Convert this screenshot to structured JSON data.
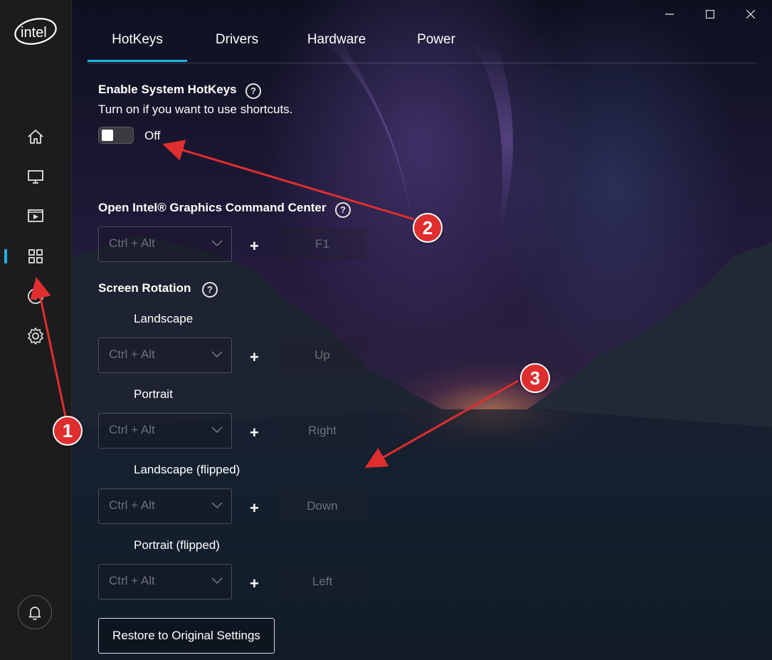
{
  "app": {
    "logo_text": "intel",
    "accent_color": "#1fb3e8",
    "annotation_color": "#e02e2e"
  },
  "sidebar": {
    "items": [
      {
        "icon": "home-icon"
      },
      {
        "icon": "display-icon"
      },
      {
        "icon": "video-icon"
      },
      {
        "icon": "apps-grid-icon",
        "active": true
      },
      {
        "icon": "help-icon"
      },
      {
        "icon": "settings-gear-icon"
      }
    ],
    "bottom_icon": "bell-icon"
  },
  "window_controls": [
    "minimize-icon",
    "maximize-icon",
    "close-icon"
  ],
  "tabs": [
    {
      "label": "HotKeys",
      "active": true
    },
    {
      "label": "Drivers"
    },
    {
      "label": "Hardware"
    },
    {
      "label": "Power"
    }
  ],
  "hotkeys": {
    "enable": {
      "title": "Enable System HotKeys",
      "description": "Turn on if you want to use shortcuts.",
      "toggle_state": "Off",
      "help": "?"
    },
    "open_igcc": {
      "title": "Open Intel® Graphics Command Center",
      "help": "?",
      "modifier": "Ctrl + Alt",
      "plus": "+",
      "key": "F1"
    },
    "screen_rotation": {
      "title": "Screen Rotation",
      "help": "?",
      "items": [
        {
          "label": "Landscape",
          "modifier": "Ctrl + Alt",
          "plus": "+",
          "key": "Up"
        },
        {
          "label": "Portrait",
          "modifier": "Ctrl + Alt",
          "plus": "+",
          "key": "Right"
        },
        {
          "label": "Landscape (flipped)",
          "modifier": "Ctrl + Alt",
          "plus": "+",
          "key": "Down"
        },
        {
          "label": "Portrait (flipped)",
          "modifier": "Ctrl + Alt",
          "plus": "+",
          "key": "Left"
        }
      ]
    },
    "restore_label": "Restore to Original Settings"
  },
  "annotations": [
    "1",
    "2",
    "3"
  ]
}
